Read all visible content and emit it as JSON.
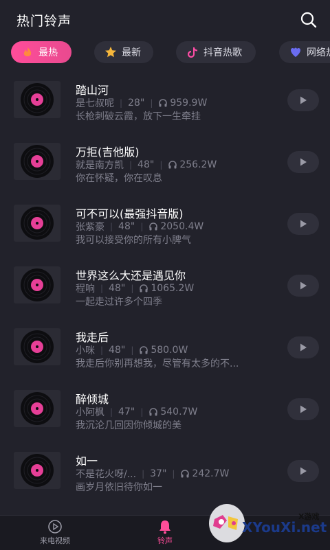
{
  "header": {
    "title": "热门铃声",
    "search_icon": "search-icon"
  },
  "tabs": [
    {
      "label": "最热",
      "icon": "fire-icon",
      "active": true
    },
    {
      "label": "最新",
      "icon": "star-icon",
      "active": false
    },
    {
      "label": "抖音热歌",
      "icon": "tiktok-icon",
      "active": false
    },
    {
      "label": "网络热",
      "icon": "network-icon",
      "active": false
    }
  ],
  "songs": [
    {
      "title": "踏山河",
      "artist": "是七叔呢",
      "duration": "28\"",
      "plays": "959.9W",
      "desc": "长枪刺破云霞，放下一生牵挂"
    },
    {
      "title": "万拒(吉他版)",
      "artist": "就是南方凯",
      "duration": "48\"",
      "plays": "256.2W",
      "desc": "你在怀疑，你在叹息"
    },
    {
      "title": "可不可以(最强抖音版)",
      "artist": "张紫豪",
      "duration": "48\"",
      "plays": "2050.4W",
      "desc": "我可以接受你的所有小脾气"
    },
    {
      "title": "世界这么大还是遇见你",
      "artist": "程响",
      "duration": "48\"",
      "plays": "1065.2W",
      "desc": "一起走过许多个四季"
    },
    {
      "title": "我走后",
      "artist": "小咪",
      "duration": "48\"",
      "plays": "580.0W",
      "desc": "我走后你别再想我，尽管有太多的不..."
    },
    {
      "title": "醉倾城",
      "artist": "小阿枫",
      "duration": "47\"",
      "plays": "540.7W",
      "desc": "我沉沦几回因你倾城的美"
    },
    {
      "title": "如一",
      "artist": "不是花火呀/...",
      "duration": "37\"",
      "plays": "242.7W",
      "desc": "画岁月依旧待你如一"
    }
  ],
  "bottom_nav": [
    {
      "label": "来电视频",
      "icon": "video-play-icon",
      "active": false
    },
    {
      "label": "铃声",
      "icon": "bell-icon",
      "active": true
    }
  ],
  "watermark": {
    "brand": "XYouXi.net",
    "small": "X游戏"
  },
  "colors": {
    "accent": "#ff4d9a",
    "background": "#22222b",
    "muted": "#7f7f8c"
  }
}
